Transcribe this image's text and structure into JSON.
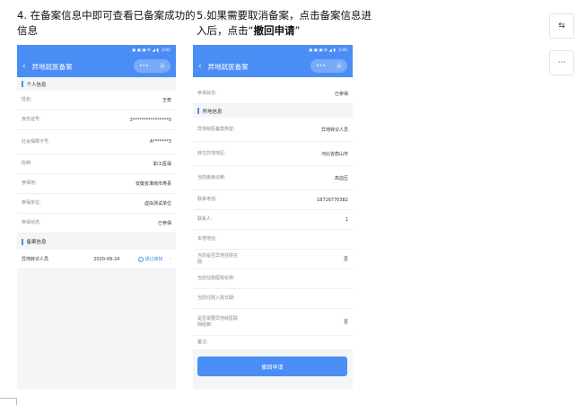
{
  "steps": {
    "s1": "4.  在备案信息中即可查看已备案成功的信息",
    "s2_pre": "5.如果需要取消备案，点击备案信息进入后，点击“",
    "s2_bold": "撤回申请",
    "s2_post": "”"
  },
  "header": {
    "title": "异地就医备案",
    "back": "‹",
    "more": "•••",
    "target": "⦿"
  },
  "status_bar": {
    "time": "3:05",
    "icons": "▣ ▣ ▣ ⚙ ◢ ▮"
  },
  "left": {
    "section1": "个人信息",
    "rows": [
      {
        "label": "姓名:",
        "value": "王奇"
      },
      {
        "label": "身份证号:",
        "value": "3****************0"
      },
      {
        "label": "社会保障卡号:",
        "value": "A*******3"
      },
      {
        "label": "险种:",
        "value": "职工医保"
      },
      {
        "label": "参保地:",
        "value": "安徽省淮南市寿县"
      },
      {
        "label": "参保单位:",
        "value": "虚拟测试单位"
      },
      {
        "label": "参保状态:",
        "value": "已参保"
      }
    ],
    "section2": "备案信息",
    "record": {
      "type": "异地转诊人员",
      "date": "2020-09-24",
      "status": "通过审核",
      "icon": "✓",
      "chev": "›"
    }
  },
  "right": {
    "top_row": {
      "label": "参保状态:",
      "value": "已参保"
    },
    "section": "异地信息",
    "rows": [
      {
        "label": "异地就医备案类型:",
        "value": "异地转诊人员"
      },
      {
        "label": "转往异地地区:",
        "value": "河北省唐山市"
      },
      {
        "label": "当前疾病诊断:",
        "value": "高血压"
      },
      {
        "label": "联系电话:",
        "value": "18716770382"
      },
      {
        "label": "联系人:",
        "value": "1"
      },
      {
        "label": "本地地址:",
        "value": ""
      },
      {
        "label": "当前是否异地住院在院:",
        "value": "否"
      },
      {
        "label": "当前住院医院名称:",
        "value": ""
      },
      {
        "label": "当前住院入院日期:",
        "value": ""
      },
      {
        "label": "是否需要异地就医联网结算:",
        "value": "否"
      },
      {
        "label": "备注:",
        "value": ""
      }
    ],
    "button": "撤回申请"
  },
  "sidebar": {
    "b1": "⇆",
    "b2": "⋯"
  }
}
